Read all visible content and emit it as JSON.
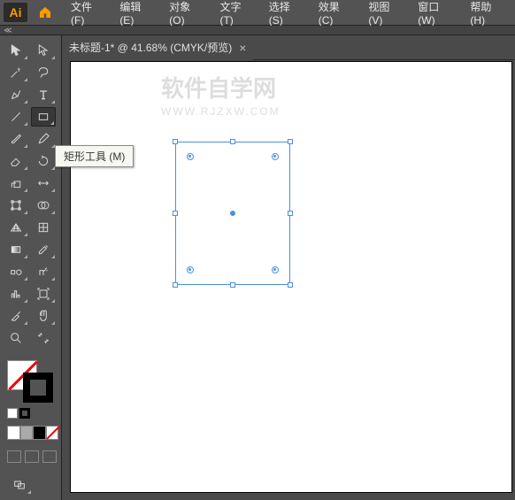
{
  "app": {
    "logo": "Ai"
  },
  "menu": {
    "file": "文件(F)",
    "edit": "编辑(E)",
    "object": "对象(O)",
    "type": "文字(T)",
    "select": "选择(S)",
    "effect": "效果(C)",
    "view": "视图(V)",
    "window": "窗口(W)",
    "help": "帮助(H)"
  },
  "tab": {
    "title": "未标题-1* @ 41.68% (CMYK/预览)",
    "close": "×"
  },
  "tooltip": "矩形工具 (M)",
  "watermark": {
    "main": "软件自学网",
    "sub": "WWW.RJZXW.COM"
  }
}
